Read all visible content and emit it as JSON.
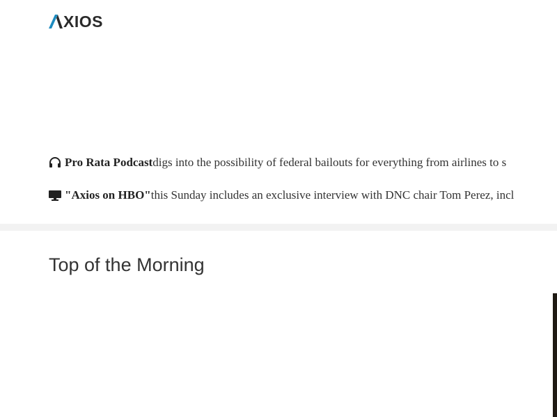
{
  "header": {
    "logo_text": "AXIOS",
    "logo_rest": "XIOS",
    "brand_accent_color": "#1d8bbf"
  },
  "promos": [
    {
      "icon": "headphones-icon",
      "strong": "Pro Rata Podcast",
      "text": " digs into the possibility of federal bailouts for everything from airlines to s"
    },
    {
      "icon": "monitor-icon",
      "strong": "\"Axios on HBO\"",
      "text": " this Sunday includes an exclusive interview with DNC chair Tom Perez, incl"
    }
  ],
  "section": {
    "title": "Top of the Morning"
  }
}
